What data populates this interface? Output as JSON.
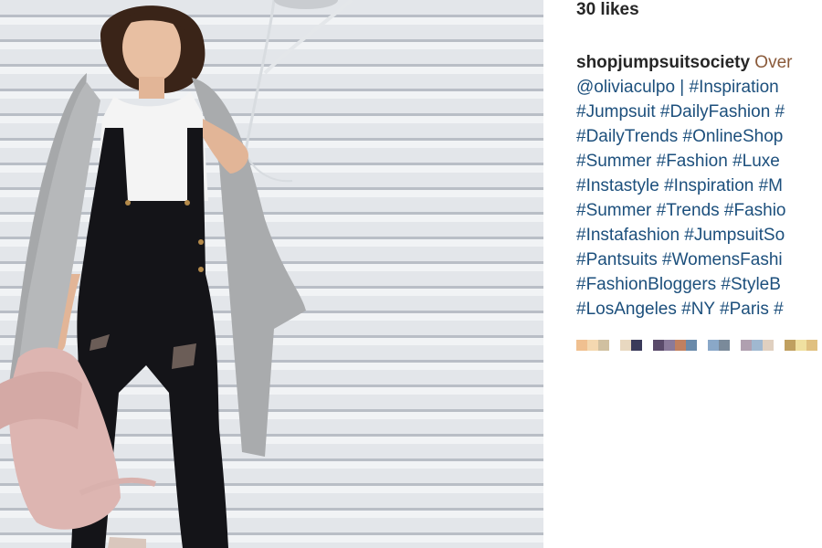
{
  "post": {
    "likes": "30 likes",
    "username": "shopjumpsuitsociety",
    "caption_start": " Over",
    "lines": [
      "@oliviaculpo | #Inspiration",
      "#Jumpsuit #DailyFashion #",
      "#DailyTrends #OnlineShop",
      "#Summer #Fashion #Luxe",
      "#Instastyle #Inspiration #M",
      "#Summer #Trends #Fashio",
      "#Instafashion #JumpsuitSo",
      "#Pantsuits #WomensFashi",
      "#FashionBloggers #StyleB",
      "#LosAngeles #NY #Paris #"
    ]
  },
  "photo": {
    "subject": "woman in black distressed overalls with grey coat and pink backpack holding balloons",
    "icon": "photo-icon"
  },
  "pixelated_row": [
    "#f0c090",
    "#f4d8b0",
    "#d0c0a0",
    "#ffffff",
    "#e8d8c0",
    "#3a3a5a",
    "#ffffff",
    "#5a4a6a",
    "#8a7a9a",
    "#c08060",
    "#6a8aaa",
    "#ffffff",
    "#8aa8c8",
    "#7a8a9a",
    "#ffffff",
    "#b0a0b0",
    "#a0b8d0",
    "#e0d0c0",
    "#ffffff",
    "#c0a060",
    "#f0e0a0",
    "#e0c080",
    "#ffffff",
    "#f0f0f0",
    "#e0e0e0",
    "#c0c0c0"
  ]
}
